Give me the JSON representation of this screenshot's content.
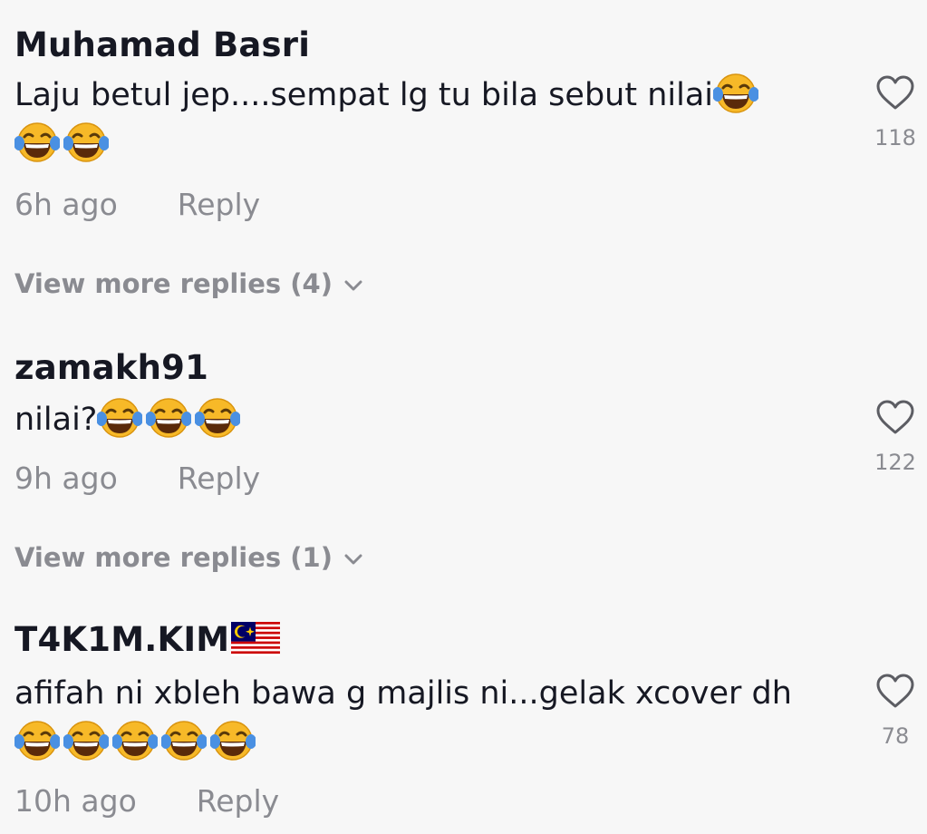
{
  "comments": [
    {
      "username": "Muhamad Basri",
      "text": "Laju betul jep....sempat lg tu bila sebut nilai",
      "emoji_after_text": 1,
      "emoji_next_line": 2,
      "time": "6h ago",
      "reply_label": "Reply",
      "like_count": "118",
      "view_more": "View more replies (4)"
    },
    {
      "username": "zamakh91",
      "text": "nilai?",
      "emoji_after_text": 3,
      "emoji_next_line": 0,
      "time": "9h ago",
      "reply_label": "Reply",
      "like_count": "122",
      "view_more": "View more replies (1)"
    },
    {
      "username": "T4K1M.KIM",
      "username_flag": "malaysia-flag-icon",
      "text": "afifah ni xbleh bawa g majlis ni...gelak xcover dh",
      "emoji_after_text": 0,
      "emoji_next_line": 5,
      "time": "10h ago",
      "reply_label": "Reply",
      "like_count": "78"
    }
  ],
  "icons": {
    "emoji": "face-with-tears-of-joy-icon",
    "like": "heart-outline-icon",
    "expand": "chevron-down-icon"
  },
  "colors": {
    "background": "#f7f7f7",
    "primary_text": "#161823",
    "secondary_text": "#8a8b91"
  }
}
